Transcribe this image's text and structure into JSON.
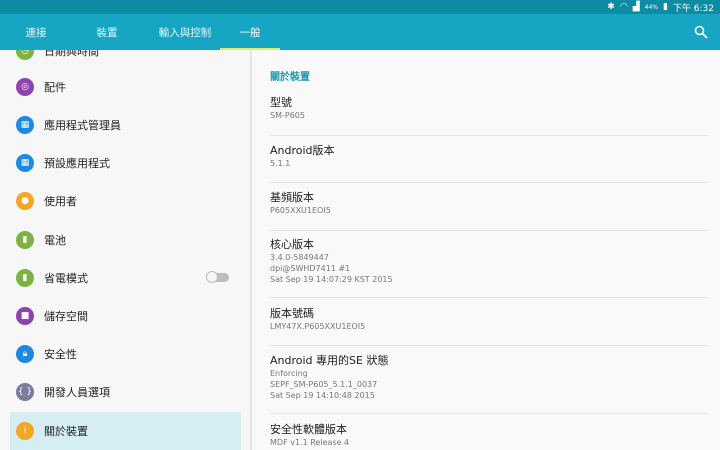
{
  "status_bar": {
    "battery": "44%",
    "time": "下午 6:32"
  },
  "tabs": [
    {
      "label": "連接"
    },
    {
      "label": "裝置"
    },
    {
      "label": "輸入與控制"
    },
    {
      "label": "一般"
    }
  ],
  "active_tab": "一般",
  "sidebar": {
    "items": [
      {
        "label": "日期與時間",
        "icon": "clock-icon",
        "color": "#7cb342"
      },
      {
        "label": "配件",
        "icon": "accessory-icon",
        "color": "#8e44ad"
      },
      {
        "label": "應用程式管理員",
        "icon": "apps-icon",
        "color": "#1e88e5"
      },
      {
        "label": "預設應用程式",
        "icon": "default-apps-icon",
        "color": "#1e88e5"
      },
      {
        "label": "使用者",
        "icon": "user-icon",
        "color": "#f5a623"
      },
      {
        "label": "電池",
        "icon": "battery-icon",
        "color": "#7cb342"
      },
      {
        "label": "省電模式",
        "icon": "power-saving-icon",
        "color": "#7cb342"
      },
      {
        "label": "儲存空間",
        "icon": "storage-icon",
        "color": "#8e44ad"
      },
      {
        "label": "安全性",
        "icon": "lock-icon",
        "color": "#1e88e5"
      },
      {
        "label": "開發人員選項",
        "icon": "developer-icon",
        "color": "#7b7b9a"
      },
      {
        "label": "關於裝置",
        "icon": "info-icon",
        "color": "#f5a623"
      }
    ]
  },
  "about": {
    "header": "關於裝置",
    "items": [
      {
        "title": "型號",
        "lines": [
          "SM-P605"
        ]
      },
      {
        "title": "Android版本",
        "lines": [
          "5.1.1"
        ]
      },
      {
        "title": "基頻版本",
        "lines": [
          "P605XXU1EOI5"
        ]
      },
      {
        "title": "核心版本",
        "lines": [
          "3.4.0-5849447",
          "dpi@SWHD7411 #1",
          "Sat Sep 19 14:07:29 KST 2015"
        ]
      },
      {
        "title": "版本號碼",
        "lines": [
          "LMY47X.P605XXU1EOI5"
        ]
      },
      {
        "title": "Android 專用的SE 狀態",
        "lines": [
          "Enforcing",
          "SEPF_SM-P605_5.1.1_0037",
          "Sat Sep 19 14:10:48 2015"
        ]
      },
      {
        "title": "安全性軟體版本",
        "lines": [
          "MDF v1.1 Release 4"
        ]
      }
    ]
  },
  "colors": {
    "status_bar": "#0d8ba3",
    "tab_bar": "#16a5c2",
    "tab_indicator": "#d7f06a",
    "section_header": "#1a9bb5",
    "selected_item": "#d5eef3"
  }
}
